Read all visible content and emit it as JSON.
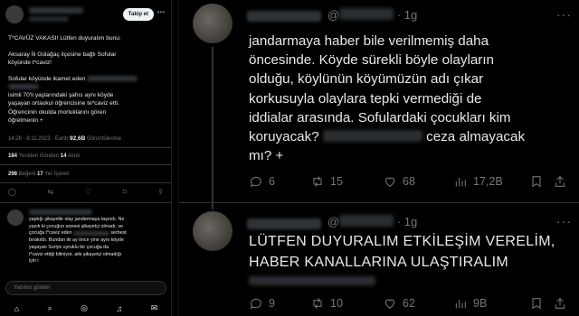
{
  "left": {
    "follow_label": "Takip et",
    "more": "•••",
    "lines": {
      "t1": "T*CAVÜZ VAKASI! Lütfen duyuralım bunu:",
      "t2a": "Aksaray İli Gülağaç ilçesine bağlı Sofular",
      "t2b": "köyünde t*caviz!",
      "t3a": "Sofular köyünde ikamet eden",
      "t4a": "isimli 70'li yaşlarındaki şahıs aynı köyde",
      "t4b": "yaşayan ortaokul öğrencisine te*caviz etti.",
      "t4c": "Öğrencinin okulda morluklarını gören",
      "t4d": "öğretmenin +"
    },
    "meta": {
      "time": "14:26 · 8.11.2023 · ",
      "source": "Earth",
      "views": "92,6B",
      "views_label": " Görüntülenme"
    },
    "stats1": {
      "reposts": "184",
      "reposts_label": " Yeniden Gönderi  ",
      "quotes": "14",
      "quotes_label": " Alıntı"
    },
    "stats2": {
      "likes": "298",
      "likes_label": " Beğeni  ",
      "bookmarks": "17",
      "bookmarks_label": " Yer İşareti"
    },
    "reply": {
      "l1": "yaptığı şikayetle olay jandarmaya taşındı. Ne",
      "l2": "yazık ki çocuğun annesi şikayetçi olmadı, ve",
      "l3a": "çocuğa t*caviz eden",
      "l3b": "serbest",
      "l4": "bırakıldı. Bundan iki ay önce yine aynı köyde",
      "l5": "yaşayan Suriye uyruklu bir çocuğa da",
      "l6a": "t*caviz ettiği biliniyor, aile şikayetçi olmadığı",
      "l6b": "için i"
    },
    "reply_placeholder": "Yanıtını gönder",
    "nav": [
      "⌂",
      "⌕",
      "◎",
      "♫",
      "✉"
    ]
  },
  "tweet1": {
    "handle": "@",
    "time": "· 1g",
    "more": "···",
    "lines": [
      "jandarmaya haber bile verilmemiş daha",
      "öncesinde. Köyde sürekli böyle olayların",
      "olduğu, köylünün köyümüzün adı çıkar",
      "korkusuyla olaylara tepki vermediği de",
      "iddialar arasında. Sofulardaki çocukları kim"
    ],
    "line6a": "koruyacak?",
    "line6b": "ceza almayacak",
    "line7": "mı? +",
    "actions": {
      "replies": "6",
      "reposts": "15",
      "likes": "68",
      "views": "17,2B"
    }
  },
  "tweet2": {
    "handle": "@",
    "time": "· 1g",
    "more": "···",
    "lines": [
      "LÜTFEN DUYURALIM ETKİLEŞİM VERELİM,",
      "HABER KANALLARINA ULAŞTIRALIM"
    ],
    "actions": {
      "replies": "9",
      "reposts": "10",
      "likes": "62",
      "views": "9B"
    }
  }
}
